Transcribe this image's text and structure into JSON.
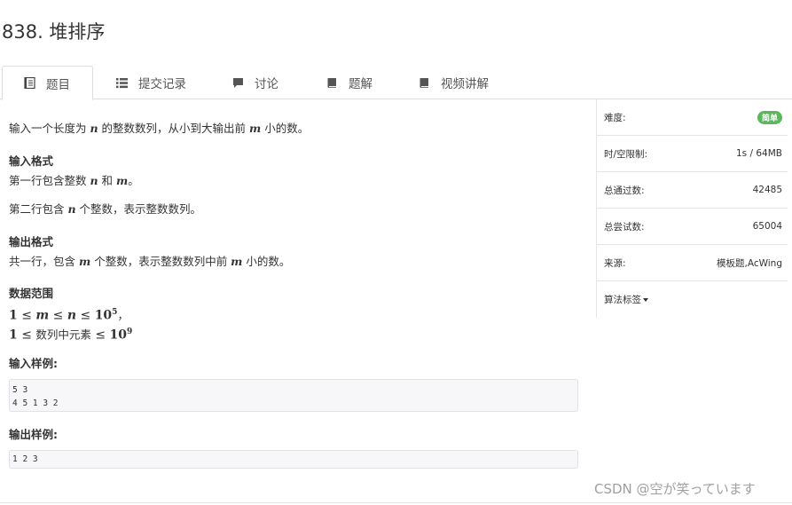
{
  "problem": {
    "title": "838. 堆排序"
  },
  "tabs": [
    {
      "label": "题目",
      "icon": "book-icon"
    },
    {
      "label": "提交记录",
      "icon": "list-icon"
    },
    {
      "label": "讨论",
      "icon": "comment-icon"
    },
    {
      "label": "题解",
      "icon": "book-icon"
    },
    {
      "label": "视频讲解",
      "icon": "book-icon"
    }
  ],
  "content": {
    "intro": {
      "pre": "输入一个长度为 ",
      "var1": "n",
      "mid": " 的整数数列，从小到大输出前 ",
      "var2": "m",
      "post": " 小的数。"
    },
    "input_format": {
      "heading": "输入格式",
      "line1": {
        "pre": "第一行包含整数 ",
        "var1": "n",
        "mid": " 和 ",
        "var2": "m",
        "post": "。"
      },
      "line2": {
        "pre": "第二行包含 ",
        "var1": "n",
        "post": " 个整数，表示整数数列。"
      }
    },
    "output_format": {
      "heading": "输出格式",
      "line1": {
        "pre": "共一行，包含 ",
        "var1": "m",
        "mid": " 个整数，表示整数数列中前 ",
        "var2": "m",
        "post": " 小的数。"
      }
    },
    "range": {
      "heading": "数据范围",
      "line1": {
        "one": "1",
        "le1": " ≤ ",
        "m": "m",
        "le2": " ≤ ",
        "n": "n",
        "le3": " ≤ ",
        "base": "10",
        "exp": "5",
        "post": "，"
      },
      "line2": {
        "one": "1",
        "le1": " ≤ ",
        "text": "数列中元素",
        "le2": " ≤ ",
        "base": "10",
        "exp": "9"
      }
    },
    "sample_input": {
      "heading": "输入样例:",
      "code": "5 3\n4 5 1 3 2"
    },
    "sample_output": {
      "heading": "输出样例:",
      "code": "1 2 3"
    }
  },
  "sidebar": {
    "difficulty_label": "难度:",
    "difficulty_value": "简单",
    "limit_label": "时/空限制:",
    "limit_value": "1s / 64MB",
    "accepted_label": "总通过数:",
    "accepted_value": "42485",
    "attempts_label": "总尝试数:",
    "attempts_value": "65004",
    "source_label": "来源:",
    "source_value": "模板题,AcWing",
    "tags_label": "算法标签"
  },
  "watermark": "CSDN @空が笑っています",
  "colors": {
    "badge": "#5cb85c",
    "border": "#dddddd",
    "code_bg": "#f7f7f9"
  }
}
